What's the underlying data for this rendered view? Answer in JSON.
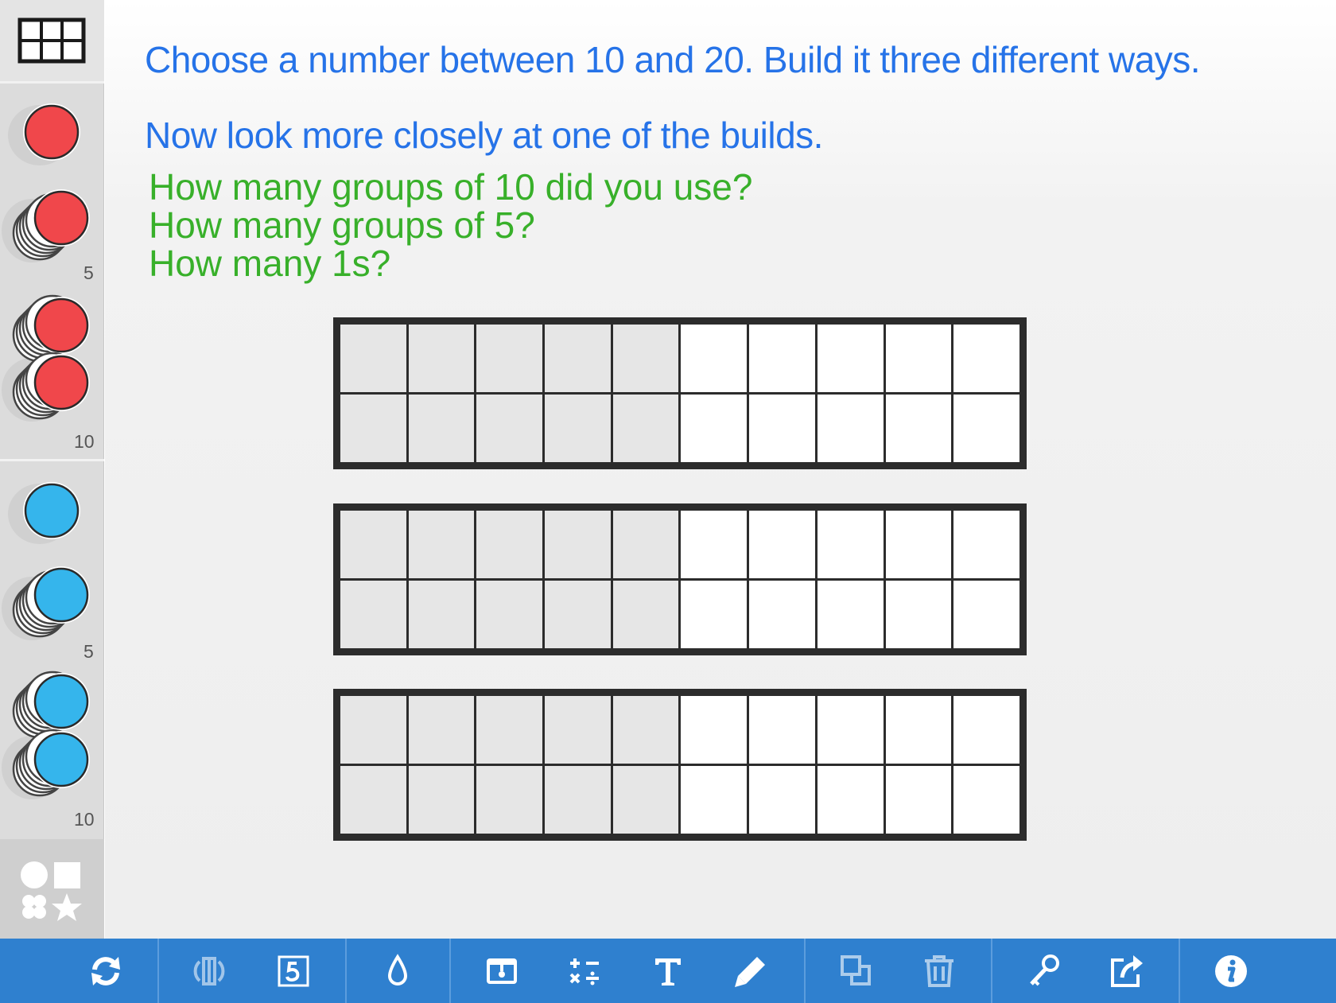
{
  "prompts": {
    "line1": "Choose a number between 10 and 20. Build it three different ways.",
    "line2": "Now look more closely at one of the builds.",
    "question1": "How many groups of 10 did you use?",
    "question2": "How many groups of 5?",
    "question3": "How many 1s?"
  },
  "sidebar": {
    "frame_tool": "ten-frame-grid-icon",
    "red_counters": {
      "color": "#f0474b",
      "single": "red-counter-icon",
      "stack5_label": "5",
      "stack10_label": "10"
    },
    "blue_counters": {
      "color": "#35b5ec",
      "single": "blue-counter-icon",
      "stack5_label": "5",
      "stack10_label": "10"
    },
    "shapes_tool": "shapes-icon"
  },
  "ten_frames": {
    "count": 3,
    "cells_per_frame": 20,
    "shaded_color": "#e6e6e6",
    "empty_color": "#ffffff"
  },
  "toolbar": {
    "background": "#2f80cf",
    "buttons": [
      "refresh-icon",
      "flip-icon",
      "five-frame-icon",
      "fill-color-icon",
      "reveal-box-icon",
      "operations-icon",
      "text-icon",
      "pen-icon",
      "duplicate-icon",
      "trash-icon",
      "key-icon",
      "share-icon",
      "info-icon"
    ]
  }
}
